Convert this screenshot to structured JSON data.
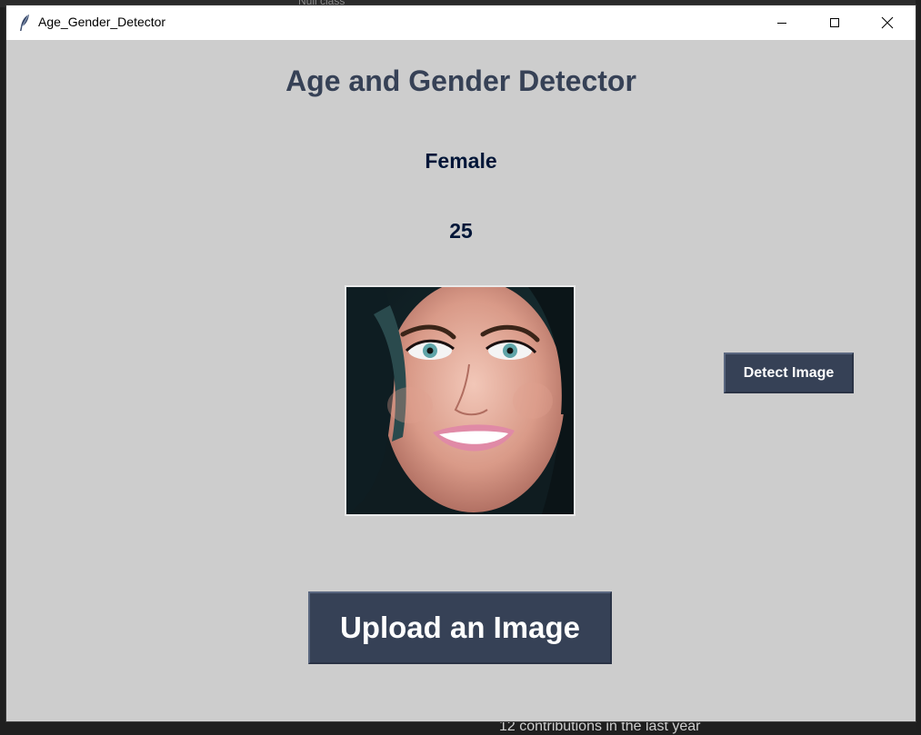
{
  "window": {
    "title": "Age_Gender_Detector"
  },
  "main": {
    "heading": "Age and Gender Detector",
    "gender_result": "Female",
    "age_result": "25",
    "detect_button": "Detect Image",
    "upload_button": "Upload an Image"
  },
  "background": {
    "bottom_text": "12 contributions in the last year",
    "top_text": "Null class"
  },
  "colors": {
    "window_bg": "#cdcdcd",
    "heading": "#364156",
    "result_text": "#011638",
    "button_bg": "#364156",
    "button_text": "#ffffff"
  }
}
